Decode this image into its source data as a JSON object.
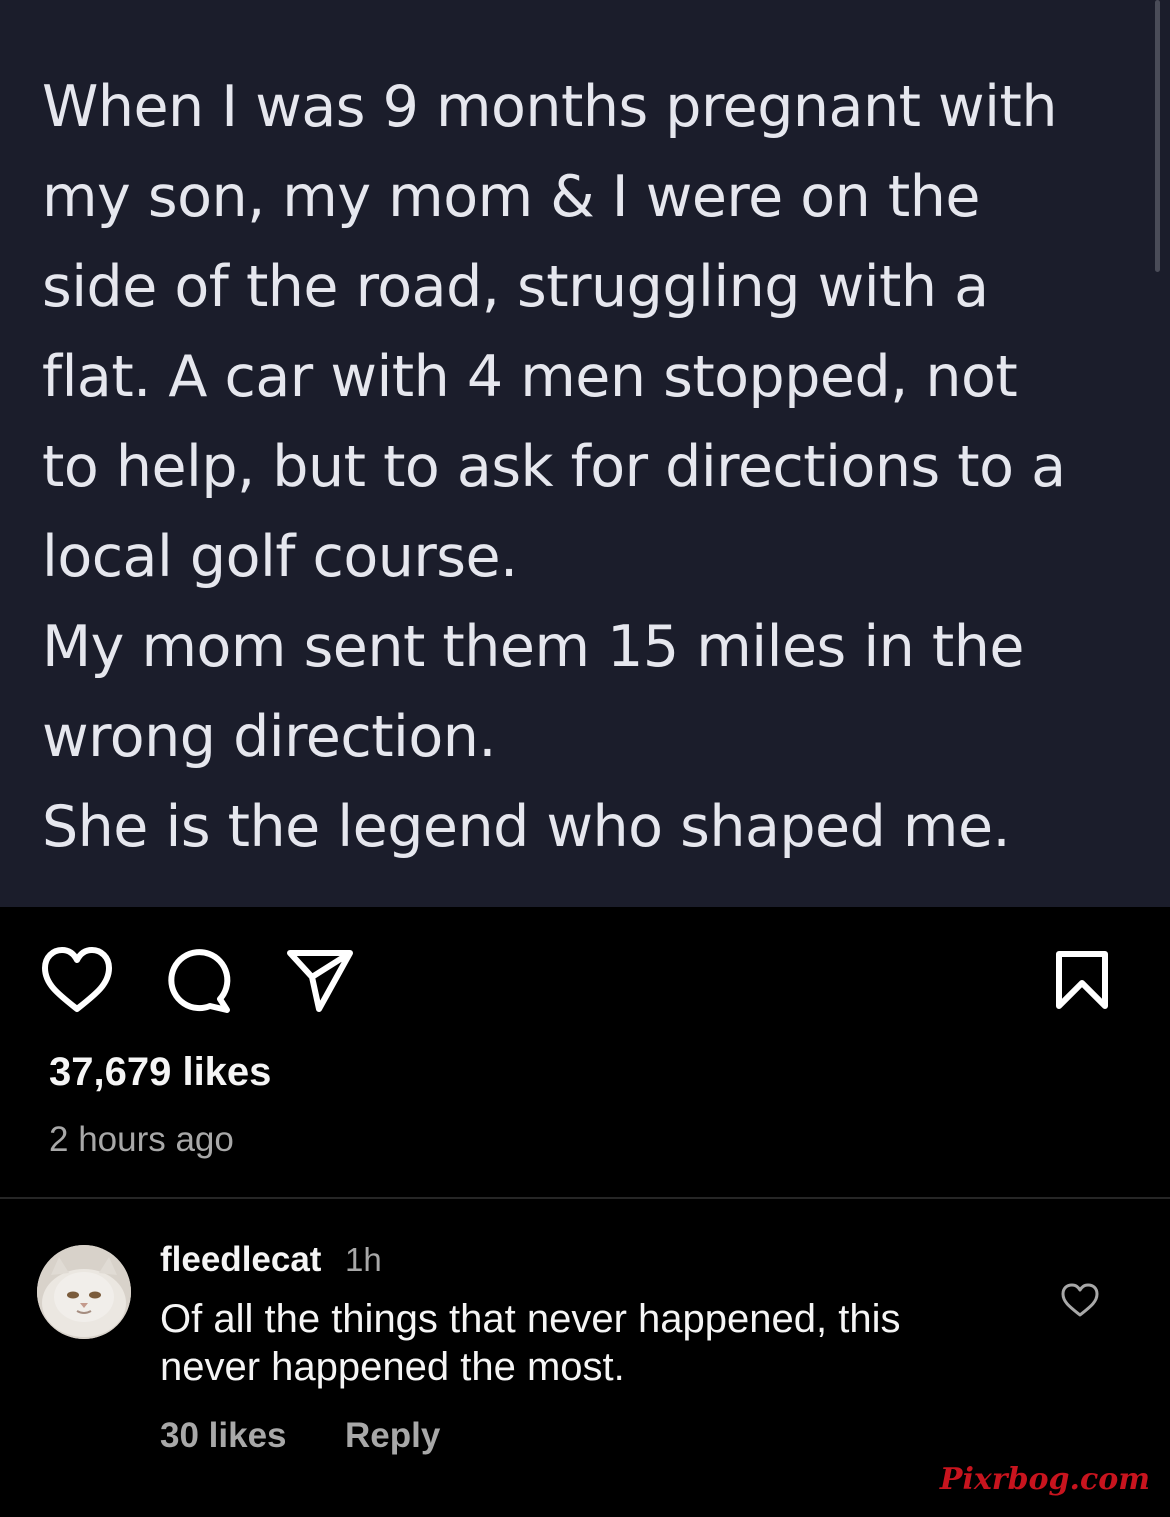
{
  "post": {
    "text_lines": [
      "When I was 9 months pregnant with",
      "my son, my mom & I were on the",
      "side of the road, struggling with a",
      "flat. A car with 4 men stopped, not",
      "to help, but to ask for directions to a",
      "local golf course.",
      "My mom sent them 15 miles in the",
      "wrong direction.",
      "She is the legend who shaped me."
    ],
    "background_color": "#1b1d2b"
  },
  "actions": {
    "like_icon": "heart-outline-icon",
    "comment_icon": "comment-bubble-icon",
    "share_icon": "paper-plane-icon",
    "save_icon": "bookmark-icon"
  },
  "likes": "37,679 likes",
  "timestamp": "2 hours ago",
  "comment": {
    "username": "fleedlecat",
    "time": "1h",
    "text_lines": [
      "Of all the things that never happened, this",
      "never happened the most."
    ],
    "likes": "30 likes",
    "reply_label": "Reply",
    "like_icon": "heart-outline-icon"
  },
  "watermark": "Pixrbog.com"
}
